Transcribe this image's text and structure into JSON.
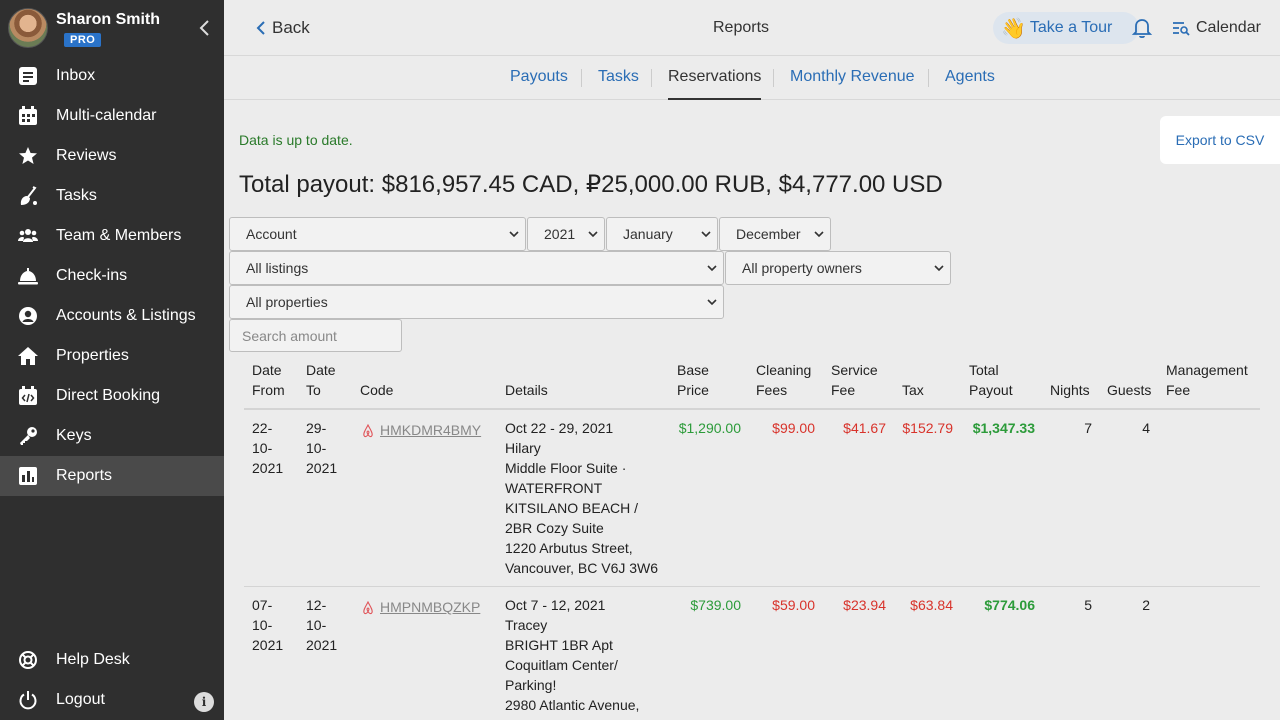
{
  "sidebar": {
    "user": {
      "name": "Sharon Smith",
      "badge": "PRO"
    },
    "items": [
      {
        "label": "Inbox",
        "icon": "inbox-icon"
      },
      {
        "label": "Multi-calendar",
        "icon": "calendar-grid-icon"
      },
      {
        "label": "Reviews",
        "icon": "star-icon"
      },
      {
        "label": "Tasks",
        "icon": "broom-icon"
      },
      {
        "label": "Team & Members",
        "icon": "team-icon"
      },
      {
        "label": "Check-ins",
        "icon": "bell-service-icon"
      },
      {
        "label": "Accounts & Listings",
        "icon": "account-icon"
      },
      {
        "label": "Properties",
        "icon": "home-icon"
      },
      {
        "label": "Direct Booking",
        "icon": "code-calendar-icon"
      },
      {
        "label": "Keys",
        "icon": "key-icon"
      },
      {
        "label": "Reports",
        "icon": "reports-icon",
        "active": true
      }
    ],
    "bottom": [
      {
        "label": "Help Desk",
        "icon": "lifebuoy-icon"
      },
      {
        "label": "Logout",
        "icon": "power-icon"
      }
    ],
    "info_label": "i"
  },
  "header": {
    "back_label": "Back",
    "title": "Reports",
    "tour_label": "Take a Tour",
    "tour_emoji": "👋",
    "calendar_label": "Calendar"
  },
  "tabs": [
    "Payouts",
    "Tasks",
    "Reservations",
    "Monthly Revenue",
    "Agents"
  ],
  "active_tab": "Reservations",
  "status_text": "Data is up to date.",
  "export_label": "Export to CSV",
  "total_payout": "Total payout: $816,957.45 CAD, ₽25,000.00 RUB, $4,777.00 USD",
  "filters": {
    "account": "Account",
    "year": "2021",
    "month_from": "January",
    "month_to": "December",
    "listings": "All listings",
    "owners": "All property owners",
    "properties": "All properties",
    "search_placeholder": "Search amount"
  },
  "table": {
    "headers": {
      "date_from": [
        "Date",
        "From"
      ],
      "date_to": [
        "Date",
        "To"
      ],
      "code": "Code",
      "details": "Details",
      "base_price": [
        "Base",
        "Price"
      ],
      "cleaning": [
        "Cleaning",
        "Fees"
      ],
      "service": [
        "Service",
        "Fee"
      ],
      "tax": "Tax",
      "total": [
        "Total",
        "Payout"
      ],
      "nights": "Nights",
      "guests": "Guests",
      "mgmt": [
        "Management",
        "Fee"
      ]
    },
    "rows": [
      {
        "date_from": [
          "22-",
          "10-",
          "2021"
        ],
        "date_to": [
          "29-",
          "10-",
          "2021"
        ],
        "code": "HMKDMR4BMY",
        "details": [
          "Oct 22 - 29, 2021",
          "Hilary",
          "Middle Floor Suite ·",
          "WATERFRONT",
          "KITSILANO BEACH /",
          "2BR Cozy Suite",
          "1220 Arbutus Street,",
          "Vancouver, BC V6J 3W6"
        ],
        "base_price": "$1,290.00",
        "cleaning": "$99.00",
        "service": "$41.67",
        "tax": "$152.79",
        "total": "$1,347.33",
        "nights": "7",
        "guests": "4"
      },
      {
        "date_from": [
          "07-",
          "10-",
          "2021"
        ],
        "date_to": [
          "12-",
          "10-",
          "2021"
        ],
        "code": "HMPNMBQZKP",
        "details": [
          "Oct 7 - 12, 2021",
          "Tracey",
          "BRIGHT 1BR Apt",
          "Coquitlam Center/",
          "Parking!",
          "2980 Atlantic Avenue,"
        ],
        "base_price": "$739.00",
        "cleaning": "$59.00",
        "service": "$23.94",
        "tax": "$63.84",
        "total": "$774.06",
        "nights": "5",
        "guests": "2"
      }
    ]
  }
}
